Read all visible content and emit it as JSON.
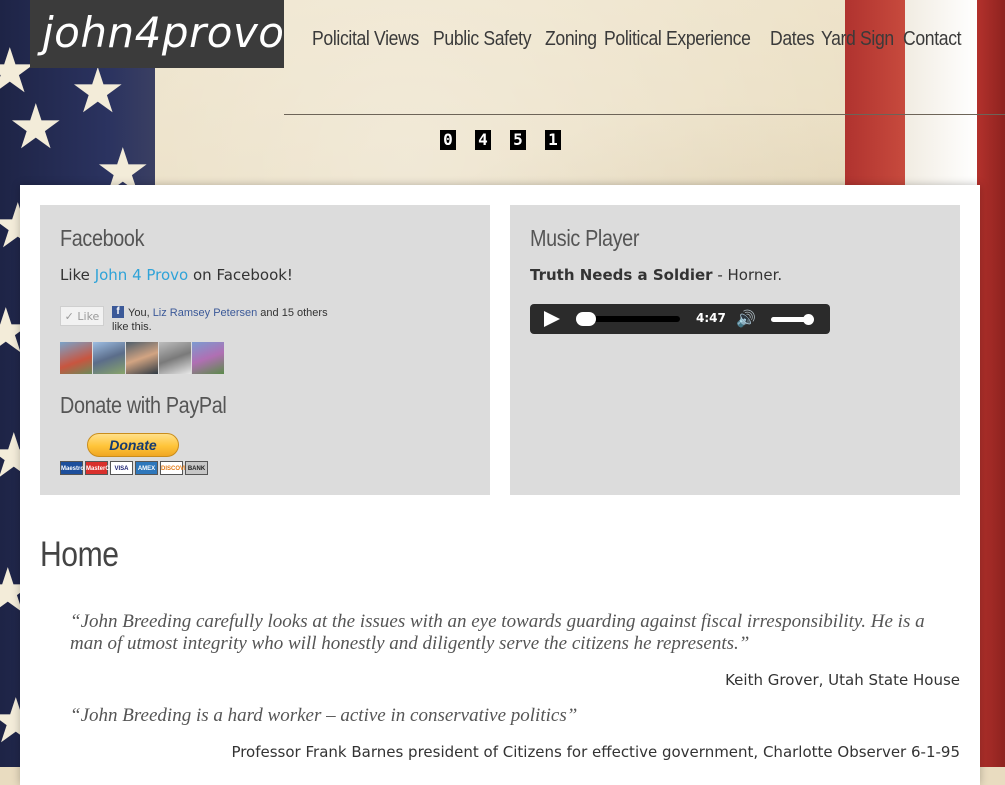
{
  "site": {
    "logo": "john4provo"
  },
  "nav": {
    "items": [
      "Policital Views",
      "Public Safety",
      "Zoning",
      "Political Experience",
      "Dates",
      "Yard Sign",
      "Contact"
    ]
  },
  "counter": {
    "digits": [
      "0",
      "4",
      "5",
      "1"
    ]
  },
  "facebook": {
    "title": "Facebook",
    "prefix": "Like ",
    "link": "John 4 Provo",
    "suffix": " on Facebook!",
    "like_button": "Like",
    "like_text_prefix": "You, ",
    "like_name": "Liz Ramsey Petersen",
    "like_text_suffix": " and 15 others like this."
  },
  "paypal": {
    "title": "Donate with PayPal",
    "button": "Donate",
    "cards": [
      "Maestro",
      "MasterCard",
      "VISA",
      "AMEX",
      "DISCOVER",
      "BANK"
    ]
  },
  "music": {
    "title": "Music Player",
    "song": "Truth Needs a Soldier",
    "artist": " - Horner.",
    "time": "4:47"
  },
  "home": {
    "title": "Home",
    "quote1": "“John Breeding carefully looks at the issues with an eye towards guarding against fiscal irresponsibility. He is a man of utmost integrity who will honestly and diligently serve the citizens he represents.”",
    "attr1": "Keith Grover, Utah State House",
    "quote2": "“John Breeding is a hard worker – active in conservative politics”",
    "attr2": "Professor Frank Barnes president of Citizens for effective government, Charlotte Observer 6-1-95"
  }
}
